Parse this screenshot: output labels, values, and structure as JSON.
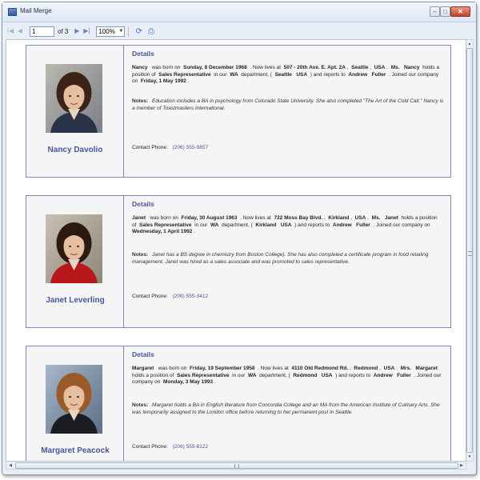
{
  "window": {
    "title": "Mail Merge",
    "minimize": "–",
    "maximize": "□",
    "close": "✕"
  },
  "toolbar": {
    "page_value": "1",
    "page_of": "of 3",
    "zoom": "100%",
    "icons": [
      "first-page-icon",
      "prev-page-icon",
      "next-page-icon",
      "last-page-icon",
      "refresh-icon",
      "print-icon"
    ]
  },
  "employees": [
    {
      "name": "Nancy   Davolio",
      "details_title": "Details",
      "first": "Nancy",
      "born_label": "was born on",
      "birth": "Sunday, 8 December 1968",
      "lives_label": ". Now lives at",
      "address": "507 - 20th Ave. E. Apt. 2A",
      "city": "Seattle",
      "country": "USA",
      "title_of_courtesy": "Ms.",
      "position_label": "holds a position of",
      "position": "Sales Representative",
      "in_label": "in our",
      "region": "WA",
      "dept_label": "department, (",
      "dept_city": "Seattle",
      "dept_country": "USA",
      "reports_label": ") and reports to",
      "manager_first": "Andrew",
      "manager_last": "Fuller",
      "joined_label": ". Joined our company on",
      "hire": "Friday, 1 May 1992",
      "notes_label": "Notes:",
      "notes": "Education includes a BA in psychology from Colorado State University.  She also completed \"The Art of the Cold Call.\"  Nancy is a member of Toastmasters International.",
      "contact_label": "Contact Phone:",
      "phone": "(206) 555-9857"
    },
    {
      "name": "Janet   Leverling",
      "details_title": "Details",
      "first": "Janet",
      "born_label": "was born on",
      "birth": "Friday, 30 August 1963",
      "lives_label": ". Now lives at",
      "address": "722 Moss Bay Blvd.",
      "city": "Kirkland",
      "country": "USA",
      "title_of_courtesy": "Ms.",
      "position_label": "holds a position of",
      "position": "Sales Representative",
      "in_label": "in our",
      "region": "WA",
      "dept_label": "department, (",
      "dept_city": "Kirkland",
      "dept_country": "USA",
      "reports_label": ") and reports to",
      "manager_first": "Andrew",
      "manager_last": "Fuller",
      "joined_label": ". Joined our company on",
      "hire": "Wednesday, 1 April 1992",
      "notes_label": "Notes:",
      "notes": "Janet has a BS degree in chemistry from Boston College).  She has also completed a certificate program in food retailing management.  Janet was hired as a sales associate and was promoted to sales representative.",
      "contact_label": "Contact Phone:",
      "phone": "(206) 555-3412"
    },
    {
      "name": "Margaret   Peacock",
      "details_title": "Details",
      "first": "Margaret",
      "born_label": "was born on",
      "birth": "Friday, 19 September 1958",
      "lives_label": ". Now lives at",
      "address": "4110 Old Redmond Rd.",
      "city": "Redmond",
      "country": "USA",
      "title_of_courtesy": "Mrs.",
      "position_label": "holds a position of",
      "position": "Sales Representative",
      "in_label": "in our",
      "region": "WA",
      "dept_label": "department, (",
      "dept_city": "Redmond",
      "dept_country": "USA",
      "reports_label": ") and reports to",
      "manager_first": "Andrew",
      "manager_last": "Fuller",
      "joined_label": ". Joined our company on",
      "hire": "Monday, 3 May 1993",
      "notes_label": "Notes:",
      "notes": "Margaret holds a BA in English literature from Concordia College and an MA from the American Institute of Culinary Arts.  She was temporarily assigned to the London office before returning to her permanent post in Seattle.",
      "contact_label": "Contact Phone:",
      "phone": "(206) 555-8122"
    }
  ]
}
